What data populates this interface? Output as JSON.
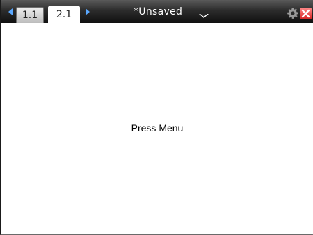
{
  "header": {
    "tabs": [
      {
        "label": "1.1",
        "active": false
      },
      {
        "label": "2.1",
        "active": true
      }
    ],
    "document_title": "*Unsaved",
    "icons": {
      "prev": "chevron-left-icon",
      "next": "chevron-right-icon",
      "menu": "dropdown-triangle-icon",
      "settings": "gear-icon",
      "close": "close-icon"
    }
  },
  "main": {
    "hint_text": "Press Menu"
  },
  "colors": {
    "toolbar_top": "#5a5a5a",
    "toolbar_bottom": "#101010",
    "nav_arrow": "#5aa8ff",
    "close_red": "#d42020"
  }
}
